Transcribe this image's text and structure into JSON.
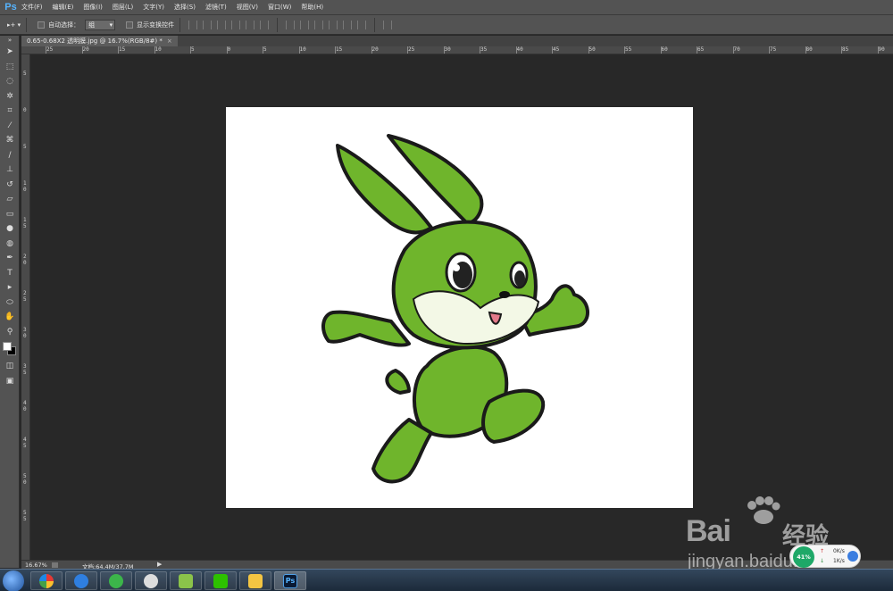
{
  "app": {
    "logo": "Ps"
  },
  "menu": [
    "文件(F)",
    "编辑(E)",
    "图像(I)",
    "图层(L)",
    "文字(Y)",
    "选择(S)",
    "滤镜(T)",
    "视图(V)",
    "窗口(W)",
    "帮助(H)"
  ],
  "options": {
    "auto_select_label": "自动选择：",
    "auto_select_value": "组",
    "show_transform_label": "显示变换控件"
  },
  "document": {
    "tab_title": "0.65-0.68X2  透明膜.jpg @ 16.7%(RGB/8#) *",
    "close": "×"
  },
  "ruler": {
    "top": [
      "25",
      "20",
      "15",
      "10",
      "5",
      "0",
      "5",
      "10",
      "15",
      "20",
      "25",
      "30",
      "35",
      "40",
      "45",
      "50",
      "55",
      "60",
      "65",
      "70",
      "75",
      "80",
      "85",
      "90"
    ],
    "left": [
      "5",
      "0",
      "5",
      "1 0",
      "1 5",
      "2 0",
      "2 5",
      "3 0",
      "3 5",
      "4 0",
      "4 5",
      "5 0",
      "5 5"
    ]
  },
  "status": {
    "zoom": "16.67%",
    "doc_size": "文档:64.4M/37.7M",
    "arrow": "▶"
  },
  "tray": {
    "percent": "41%",
    "up_arrow": "↑",
    "down_arrow": "↓",
    "up_speed": "0K/s",
    "down_speed": "1K/s"
  },
  "watermark": {
    "brand": "Bai",
    "brand_cn": "经验",
    "url": "jingyan.baidu.com"
  },
  "taskbar": {
    "ps_label": "Ps"
  },
  "colors": {
    "workspace": "#282828",
    "panel": "#535353",
    "rabbit_green": "#6fb52c",
    "accent_blue": "#56b4ff"
  },
  "icons": {
    "tools": [
      "move-tool-icon",
      "marquee-icon",
      "lasso-icon",
      "magic-wand-icon",
      "crop-icon",
      "eyedropper-icon",
      "healing-brush-icon",
      "brush-icon",
      "clone-stamp-icon",
      "history-brush-icon",
      "eraser-icon",
      "gradient-icon",
      "blur-icon",
      "dodge-icon",
      "pen-icon",
      "type-icon",
      "path-selection-icon",
      "ellipse-icon",
      "hand-icon",
      "zoom-icon"
    ]
  }
}
